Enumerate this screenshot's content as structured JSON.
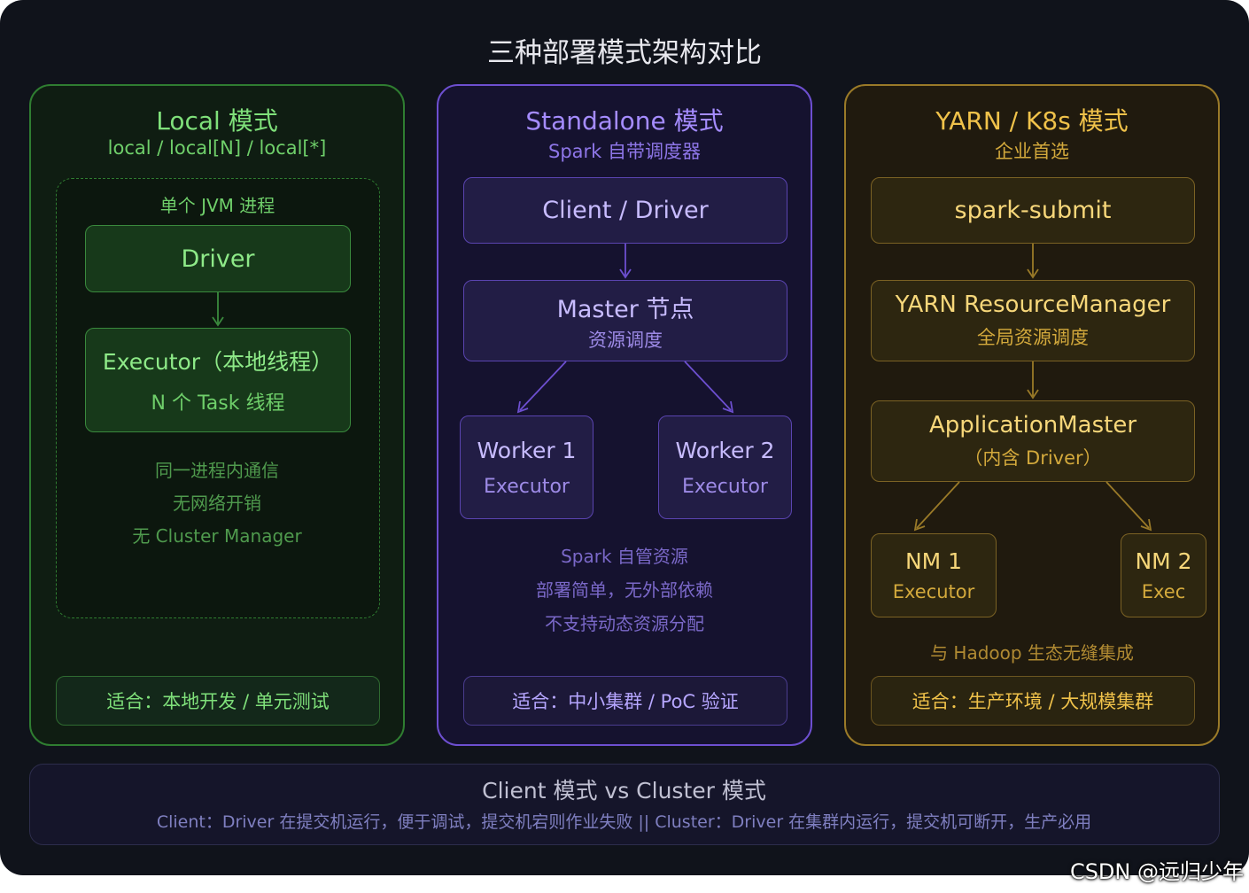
{
  "title": "三种部署模式架构对比",
  "local": {
    "header": "Local 模式",
    "subheader": "local / local[N] / local[*]",
    "jvm_label": "单个 JVM 进程",
    "driver": "Driver",
    "executor": "Executor（本地线程）",
    "executor_sub": "N 个 Task 线程",
    "notes": [
      "同一进程内通信",
      "无网络开销",
      "无 Cluster Manager"
    ],
    "fit": "适合：本地开发 / 单元测试",
    "color": "#7fe07a"
  },
  "standalone": {
    "header": "Standalone 模式",
    "subheader": "Spark 自带调度器",
    "client": "Client / Driver",
    "master": "Master 节点",
    "master_sub": "资源调度",
    "workers": [
      {
        "name": "Worker 1",
        "sub": "Executor"
      },
      {
        "name": "Worker 2",
        "sub": "Executor"
      }
    ],
    "notes": [
      "Spark 自管资源",
      "部署简单，无外部依赖",
      "不支持动态资源分配"
    ],
    "fit": "适合：中小集群 / PoC 验证",
    "color": "#a58cff"
  },
  "yarn": {
    "header": "YARN / K8s 模式",
    "subheader": "企业首选",
    "submit": "spark-submit",
    "rm": "YARN ResourceManager",
    "rm_sub": "全局资源调度",
    "am": "ApplicationMaster",
    "am_sub": "（内含 Driver）",
    "nms": [
      {
        "name": "NM 1",
        "sub": "Executor"
      },
      {
        "name": "NM 2",
        "sub": "Exec"
      }
    ],
    "note": "与 Hadoop 生态无缝集成",
    "fit": "适合：生产环境 / 大规模集群",
    "color": "#f0c24a"
  },
  "compare": {
    "title": "Client 模式 vs Cluster 模式",
    "text": "Client：Driver 在提交机运行，便于调试，提交机宕则作业失败 || Cluster：Driver 在集群内运行，提交机可断开，生产必用"
  },
  "credit": "CSDN @远归少年"
}
